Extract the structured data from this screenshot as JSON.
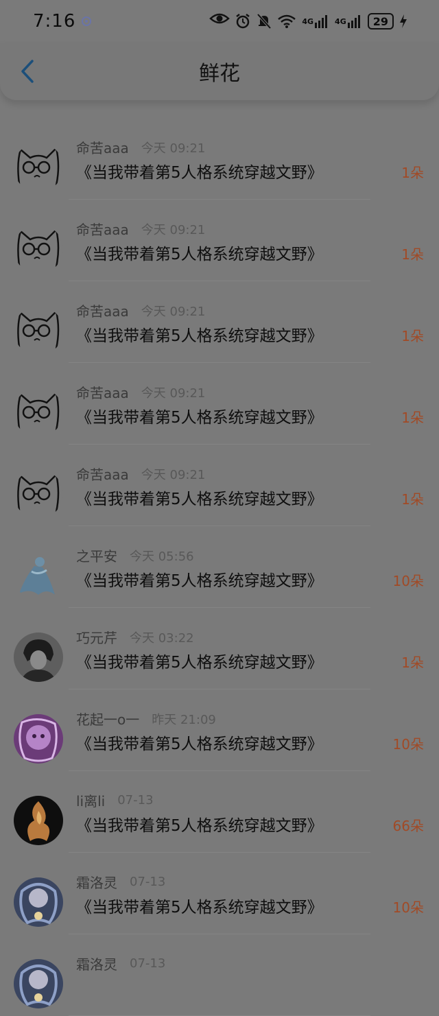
{
  "status_bar": {
    "time": "7:16",
    "battery": "29",
    "network_1": "4G",
    "network_2": "4G",
    "icons": [
      "settings-badge-icon",
      "eye-icon",
      "alarm-icon",
      "mute-icon",
      "wifi-icon",
      "signal-icon",
      "signal-icon",
      "battery-icon",
      "charging-icon"
    ]
  },
  "nav": {
    "title": "鲜花"
  },
  "items": [
    {
      "name": "命苦aaa",
      "time": "今天 09:21",
      "book": "《当我带着第5人格系统穿越文野》",
      "count": "1朵",
      "avatar": "cat"
    },
    {
      "name": "命苦aaa",
      "time": "今天 09:21",
      "book": "《当我带着第5人格系统穿越文野》",
      "count": "1朵",
      "avatar": "cat"
    },
    {
      "name": "命苦aaa",
      "time": "今天 09:21",
      "book": "《当我带着第5人格系统穿越文野》",
      "count": "1朵",
      "avatar": "cat"
    },
    {
      "name": "命苦aaa",
      "time": "今天 09:21",
      "book": "《当我带着第5人格系统穿越文野》",
      "count": "1朵",
      "avatar": "cat"
    },
    {
      "name": "命苦aaa",
      "time": "今天 09:21",
      "book": "《当我带着第5人格系统穿越文野》",
      "count": "1朵",
      "avatar": "cat"
    },
    {
      "name": "之平安",
      "time": "今天 05:56",
      "book": "《当我带着第5人格系统穿越文野》",
      "count": "10朵",
      "avatar": "figure"
    },
    {
      "name": "巧元芹",
      "time": "今天 03:22",
      "book": "《当我带着第5人格系统穿越文野》",
      "count": "1朵",
      "avatar": "dark"
    },
    {
      "name": "花起一o一",
      "time": "昨天 21:09",
      "book": "《当我带着第5人格系统穿越文野》",
      "count": "10朵",
      "avatar": "purple"
    },
    {
      "name": "li离li",
      "time": "07-13",
      "book": "《当我带着第5人格系统穿越文野》",
      "count": "66朵",
      "avatar": "fire"
    },
    {
      "name": "霜洛灵",
      "time": "07-13",
      "book": "《当我带着第5人格系统穿越文野》",
      "count": "10朵",
      "avatar": "blue"
    },
    {
      "name": "霜洛灵",
      "time": "07-13",
      "book": "",
      "count": "",
      "avatar": "blue"
    }
  ]
}
